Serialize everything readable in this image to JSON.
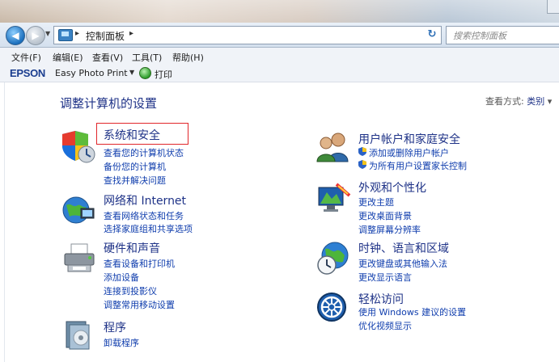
{
  "window": {
    "address": {
      "crumb": "控制面板",
      "separator": "▸"
    },
    "search_placeholder": "搜索控制面板"
  },
  "menu": [
    "文件(F)",
    "编辑(E)",
    "查看(V)",
    "工具(T)",
    "帮助(H)"
  ],
  "epson_bar": {
    "logo": "EPSON",
    "app": "Easy Photo Print",
    "print": "打印"
  },
  "page": {
    "heading": "调整计算机的设置",
    "view_label": "查看方式:",
    "view_value": "类别",
    "view_arrow": "▾"
  },
  "categories": {
    "system": {
      "title": "系统和安全",
      "links": [
        "查看您的计算机状态",
        "备份您的计算机",
        "查找并解决问题"
      ]
    },
    "network": {
      "title": "网络和 Internet",
      "links": [
        "查看网络状态和任务",
        "选择家庭组和共享选项"
      ]
    },
    "hardware": {
      "title": "硬件和声音",
      "links": [
        "查看设备和打印机",
        "添加设备",
        "连接到投影仪",
        "调整常用移动设置"
      ]
    },
    "programs": {
      "title": "程序",
      "links": [
        "卸载程序"
      ]
    },
    "user": {
      "title": "用户帐户和家庭安全",
      "links": [
        "添加或删除用户帐户",
        "为所有用户设置家长控制"
      ]
    },
    "appearance": {
      "title": "外观和个性化",
      "links": [
        "更改主题",
        "更改桌面背景",
        "调整屏幕分辨率"
      ]
    },
    "clock": {
      "title": "时钟、语言和区域",
      "links": [
        "更改键盘或其他输入法",
        "更改显示语言"
      ]
    },
    "ease": {
      "title": "轻松访问",
      "links": [
        "使用 Windows 建议的设置",
        "优化视频显示"
      ]
    }
  }
}
